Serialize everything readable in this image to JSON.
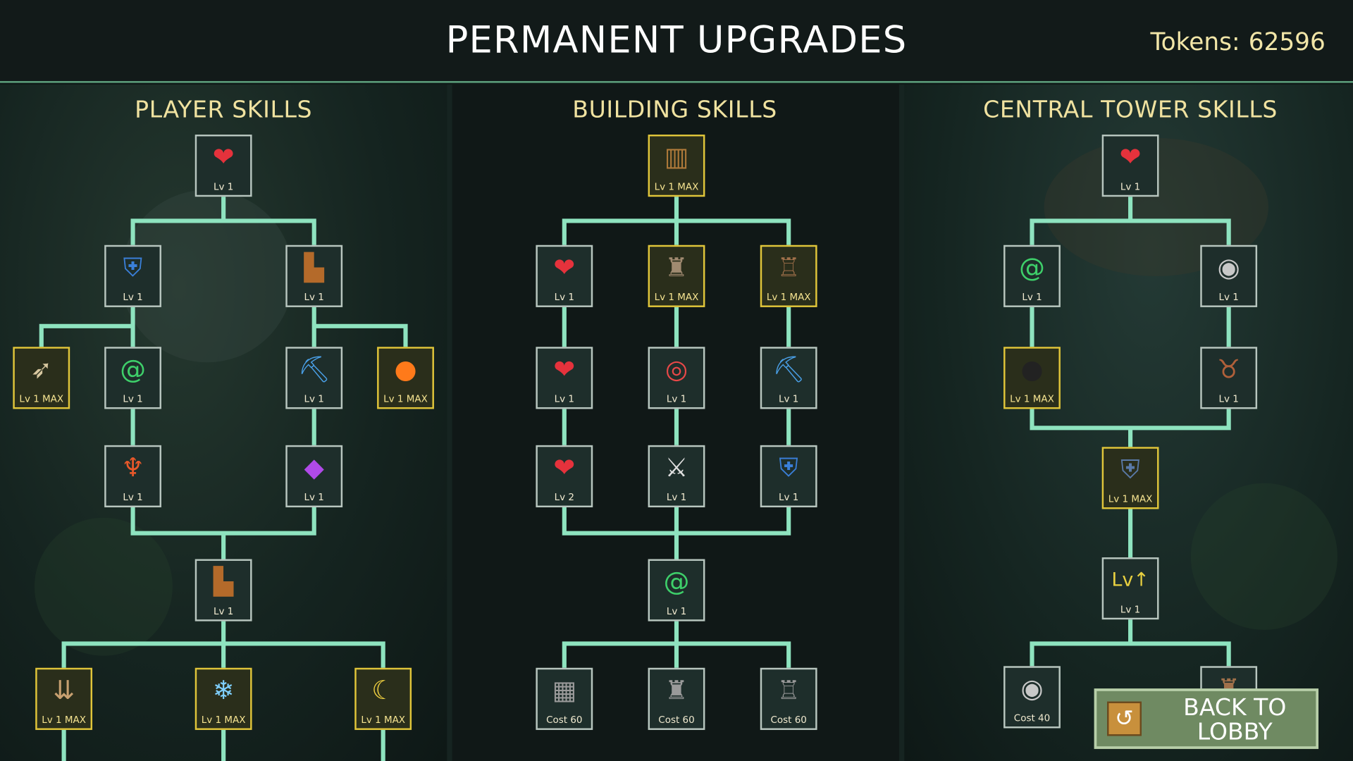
{
  "header": {
    "title": "PERMANENT UPGRADES",
    "tokens_label": "Tokens:",
    "tokens_value": "62596"
  },
  "columns": {
    "player": "PLAYER SKILLS",
    "building": "BUILDING SKILLS",
    "tower": "CENTRAL TOWER SKILLS"
  },
  "player_skills": [
    {
      "icon": "heart-plus",
      "label": "Lv 1"
    },
    {
      "icon": "shield",
      "label": "Lv 1"
    },
    {
      "icon": "boot",
      "label": "Lv 1"
    },
    {
      "icon": "arrow",
      "label": "Lv 1 MAX"
    },
    {
      "icon": "spiral",
      "label": "Lv 1"
    },
    {
      "icon": "shovel",
      "label": "Lv 1"
    },
    {
      "icon": "fireball",
      "label": "Lv 1 MAX"
    },
    {
      "icon": "phoenix",
      "label": "Lv 1"
    },
    {
      "icon": "xp-gem",
      "label": "Lv 1"
    },
    {
      "icon": "boot",
      "label": "Lv 1"
    },
    {
      "icon": "arrows-rain",
      "label": "Lv 1 MAX"
    },
    {
      "icon": "snowflake",
      "label": "Lv 1 MAX"
    },
    {
      "icon": "sword-slash",
      "label": "Lv 1 MAX"
    }
  ],
  "building_skills": [
    {
      "icon": "wall",
      "label": "Lv 1 MAX"
    },
    {
      "icon": "wall-heart",
      "label": "Lv 1"
    },
    {
      "icon": "castle",
      "label": "Lv 1 MAX"
    },
    {
      "icon": "tower",
      "label": "Lv 1 MAX"
    },
    {
      "icon": "wall-heart",
      "label": "Lv 1"
    },
    {
      "icon": "castle-target",
      "label": "Lv 1"
    },
    {
      "icon": "tower-shovel",
      "label": "Lv 1"
    },
    {
      "icon": "wall-heart",
      "label": "Lv 2"
    },
    {
      "icon": "castle-sword",
      "label": "Lv 1"
    },
    {
      "icon": "tower-shield",
      "label": "Lv 1"
    },
    {
      "icon": "wall-spiral",
      "label": "Lv 1"
    },
    {
      "icon": "gate",
      "label": "Cost 60"
    },
    {
      "icon": "castle",
      "label": "Cost 60"
    },
    {
      "icon": "tower",
      "label": "Cost 60"
    }
  ],
  "tower_skills": [
    {
      "icon": "tower-heart",
      "label": "Lv 1"
    },
    {
      "icon": "tower-spiral",
      "label": "Lv 1"
    },
    {
      "icon": "coin",
      "label": "Lv 1"
    },
    {
      "icon": "cannonball",
      "label": "Lv 1 MAX"
    },
    {
      "icon": "boar",
      "label": "Lv 1"
    },
    {
      "icon": "crest-shield",
      "label": "Lv 1 MAX"
    },
    {
      "icon": "level-up",
      "label": "Lv 1"
    },
    {
      "icon": "coin",
      "label": "Cost 40"
    }
  ],
  "back_button": {
    "label": "BACK TO LOBBY"
  }
}
